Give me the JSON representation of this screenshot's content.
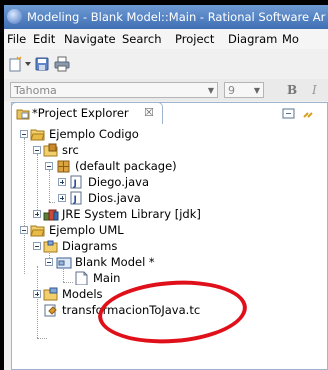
{
  "window": {
    "title": "Modeling - Blank Model::Main - Rational Software Ar"
  },
  "menu": [
    "File",
    "Edit",
    "Navigate",
    "Search",
    "Project",
    "Diagram",
    "Mo"
  ],
  "font_bar": {
    "font": "Tahoma",
    "size": "9",
    "bold": "B",
    "italic": "I"
  },
  "explorer": {
    "tab_label": "*Project Explorer",
    "close": "☒",
    "tree": {
      "ejemplo_codigo": "Ejemplo Codigo",
      "src": "src",
      "default_package": "(default package)",
      "diego": "Diego.java",
      "dios": "Dios.java",
      "jre": "JRE System Library [jdk]",
      "ejemplo_uml": "Ejemplo UML",
      "diagrams": "Diagrams",
      "blank_model": "Blank Model *",
      "main": "Main",
      "models": "Models",
      "transformacion": "transformacionToJava.tc"
    }
  },
  "colors": {
    "title_bar": "#4f7fc2",
    "annotation_ring": "#e0101a",
    "panel_border": "#9fb5cf"
  }
}
